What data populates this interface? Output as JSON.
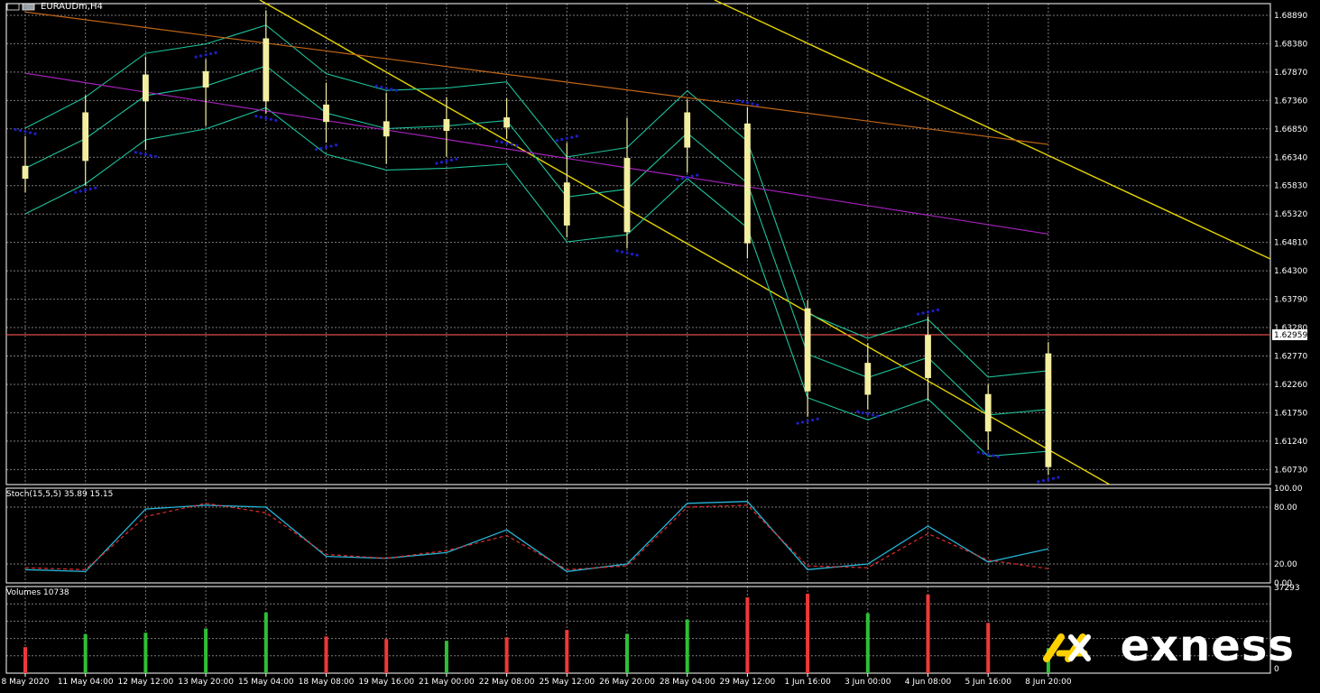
{
  "window": {
    "title": "EURAUDm,H4"
  },
  "panels": {
    "price_axis_ticks": [
      "1.68890",
      "1.68380",
      "1.67870",
      "1.67360",
      "1.66850",
      "1.66340",
      "1.65830",
      "1.65320",
      "1.64810",
      "1.64300",
      "1.63790",
      "1.63280",
      "1.62770",
      "1.62260",
      "1.61750",
      "1.61240",
      "1.60730"
    ],
    "current_price_label": "1.62959",
    "stoch_label": "Stoch(15,5,5) 35.89 15.15",
    "stoch_axis_ticks": [
      "100.00",
      "80.00",
      "20.00",
      "0.00"
    ],
    "volume_label": "Volumes 10738",
    "volume_axis_max": "37293",
    "volume_axis_min": "0",
    "time_axis_labels": [
      "8 May 2020",
      "11 May 04:00",
      "12 May 12:00",
      "13 May 20:00",
      "15 May 04:00",
      "18 May 08:00",
      "19 May 16:00",
      "21 May 00:00",
      "22 May 08:00",
      "25 May 12:00",
      "26 May 20:00",
      "28 May 04:00",
      "29 May 12:00",
      "1 Jun 16:00",
      "3 Jun 00:00",
      "4 Jun 08:00",
      "5 Jun 16:00",
      "8 Jun 20:00"
    ]
  },
  "branding": {
    "wordmark": "exness"
  },
  "colors": {
    "background": "#000000",
    "grid": "#7a7a7a",
    "axis": "#ffffff",
    "text": "#ffffff",
    "candle": "#f3eea0",
    "trendline": "#e6d500",
    "bollinger": "#1cc39c",
    "ma_purple": "#a221b8",
    "ma_brown": "#c06515",
    "psar": "#1f1ec7",
    "current_line": "#e04b4b",
    "stoch_main": "#25b6d8",
    "stoch_signal": "#e02c2c",
    "volume_up": "#2fbf36",
    "volume_down": "#ef3838",
    "brand_yellow": "#ffd200"
  },
  "chart_data": [
    {
      "type": "candlestick",
      "x": [
        "8 May 2020",
        "11 May 04:00",
        "12 May 12:00",
        "13 May 20:00",
        "15 May 04:00",
        "18 May 08:00",
        "19 May 16:00",
        "21 May 00:00",
        "22 May 08:00",
        "25 May 12:00",
        "26 May 20:00",
        "28 May 04:00",
        "29 May 12:00",
        "1 Jun 16:00",
        "3 Jun 00:00",
        "4 Jun 08:00",
        "5 Jun 16:00",
        "8 Jun 20:00"
      ],
      "series": [
        {
          "values": [
            {
              "open": 1.6618,
              "high": 1.6672,
              "low": 1.6571,
              "close": 1.6596
            },
            {
              "open": 1.6628,
              "high": 1.6745,
              "low": 1.6583,
              "close": 1.6714
            },
            {
              "open": 1.6735,
              "high": 1.6815,
              "low": 1.6647,
              "close": 1.6782
            },
            {
              "open": 1.676,
              "high": 1.681,
              "low": 1.669,
              "close": 1.6788
            },
            {
              "open": 1.6735,
              "high": 1.6898,
              "low": 1.6712,
              "close": 1.6847
            },
            {
              "open": 1.6728,
              "high": 1.6768,
              "low": 1.666,
              "close": 1.6698
            },
            {
              "open": 1.6698,
              "high": 1.675,
              "low": 1.6622,
              "close": 1.6672
            },
            {
              "open": 1.6682,
              "high": 1.6742,
              "low": 1.6635,
              "close": 1.6702
            },
            {
              "open": 1.6705,
              "high": 1.674,
              "low": 1.6667,
              "close": 1.6688
            },
            {
              "open": 1.6588,
              "high": 1.666,
              "low": 1.649,
              "close": 1.6512
            },
            {
              "open": 1.65,
              "high": 1.6705,
              "low": 1.647,
              "close": 1.6632
            },
            {
              "open": 1.6652,
              "high": 1.6738,
              "low": 1.6606,
              "close": 1.6714
            },
            {
              "open": 1.6694,
              "high": 1.6724,
              "low": 1.6452,
              "close": 1.648
            },
            {
              "open": 1.6362,
              "high": 1.6377,
              "low": 1.6168,
              "close": 1.6214
            },
            {
              "open": 1.6208,
              "high": 1.63,
              "low": 1.6181,
              "close": 1.6264
            },
            {
              "open": 1.6314,
              "high": 1.6348,
              "low": 1.6197,
              "close": 1.6238
            },
            {
              "open": 1.6208,
              "high": 1.6226,
              "low": 1.6108,
              "close": 1.6142
            },
            {
              "open": 1.6078,
              "high": 1.6302,
              "low": 1.6063,
              "close": 1.6281
            }
          ]
        }
      ],
      "ylim": [
        1.6046,
        1.691
      ]
    },
    {
      "type": "line",
      "x": [
        "8 May 2020",
        "11 May 04:00",
        "12 May 12:00",
        "13 May 20:00",
        "15 May 04:00",
        "18 May 08:00",
        "19 May 16:00",
        "21 May 00:00",
        "22 May 08:00",
        "25 May 12:00",
        "26 May 20:00",
        "28 May 04:00",
        "29 May 12:00",
        "1 Jun 16:00",
        "3 Jun 00:00",
        "4 Jun 08:00",
        "5 Jun 16:00",
        "8 Jun 20:00"
      ],
      "series": [
        {
          "values": [
            14,
            12,
            78,
            82,
            80,
            28,
            26,
            32,
            56,
            12,
            20,
            84,
            86,
            14,
            20,
            60,
            22,
            36
          ]
        },
        {
          "values": [
            16,
            14,
            70,
            84,
            74,
            30,
            26,
            34,
            50,
            14,
            18,
            80,
            82,
            18,
            16,
            52,
            24,
            15
          ]
        }
      ],
      "ylim": [
        0,
        100
      ]
    },
    {
      "type": "bar",
      "x": [
        "8 May 2020",
        "11 May 04:00",
        "12 May 12:00",
        "13 May 20:00",
        "15 May 04:00",
        "18 May 08:00",
        "19 May 16:00",
        "21 May 00:00",
        "22 May 08:00",
        "25 May 12:00",
        "26 May 20:00",
        "28 May 04:00",
        "29 May 12:00",
        "1 Jun 16:00",
        "3 Jun 00:00",
        "4 Jun 08:00",
        "5 Jun 16:00",
        "8 Jun 20:00"
      ],
      "series": [
        {
          "values": [
            11200,
            16800,
            17400,
            19200,
            26100,
            15800,
            14700,
            13900,
            15400,
            18600,
            16900,
            23100,
            32600,
            34200,
            25800,
            33800,
            21600,
            10738
          ]
        }
      ],
      "ylim": [
        0,
        37293
      ]
    }
  ]
}
